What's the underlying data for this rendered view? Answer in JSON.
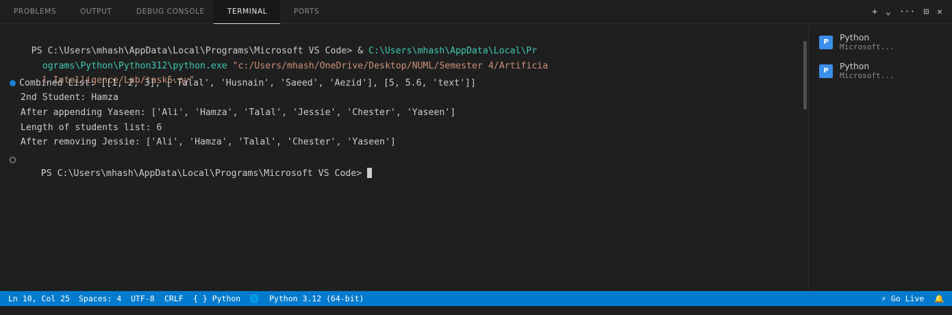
{
  "panel": {
    "tabs": [
      {
        "label": "PROBLEMS"
      },
      {
        "label": "OUTPUT"
      },
      {
        "label": "DEBUG CONSOLE"
      },
      {
        "label": "TERMINAL"
      },
      {
        "label": "PORTS"
      }
    ],
    "active_tab": "TERMINAL",
    "actions": {
      "add": "+",
      "split_menu": "⌄",
      "more": "···",
      "maximize": "⊡",
      "close": "✕"
    }
  },
  "terminal": {
    "cmd_prompt": "PS C:\\Users\\mhash\\AppData\\Local\\Programs\\Microsoft VS Code> & ",
    "cmd_exe_1": "C:\\Users\\mhash\\AppData\\Local\\Pr",
    "cmd_exe_2": "ograms\\Python\\Python312\\python.exe",
    "cmd_arg_1": " \"c:/Users/mhash/OneDrive/Desktop/NUML/Semester 4/Artificia",
    "cmd_arg_2": "l Intelligence/Lab/task5.py\"",
    "output": [
      "Combined List: [[1, 2, 3], ['Talal', 'Husnain', 'Saeed', 'Aezid'], [5, 5.6, 'text']]",
      "2nd Student: Hamza",
      "After appending Yaseen: ['Ali', 'Hamza', 'Talal', 'Jessie', 'Chester', 'Yaseen']",
      "Length of students list: 6",
      "After removing Jessie: ['Ali', 'Hamza', 'Talal', 'Chester', 'Yaseen']"
    ],
    "prompt": "PS C:\\Users\\mhash\\AppData\\Local\\Programs\\Microsoft VS Code> "
  },
  "terminal_list": [
    {
      "title": "Python",
      "subtitle": "Microsoft...",
      "icon": "python-icon",
      "icon_glyph": "P"
    },
    {
      "title": "Python",
      "subtitle": "Microsoft...",
      "icon": "python-icon",
      "icon_glyph": "P"
    }
  ],
  "statusbar": {
    "position": "Ln 10, Col 25",
    "spaces": "Spaces: 4",
    "encoding": "UTF-8",
    "eol": "CRLF",
    "language": "{ } Python",
    "globe_icon": "🌐",
    "interpreter": "Python 3.12 (64-bit)",
    "go_live": "⚡ Go Live",
    "bell_icon": "🔔"
  },
  "colors": {
    "statusbar_bg": "#007acc",
    "path": "#3fc9b0",
    "string": "#ce9178",
    "success_dot": "#1b81d4"
  }
}
